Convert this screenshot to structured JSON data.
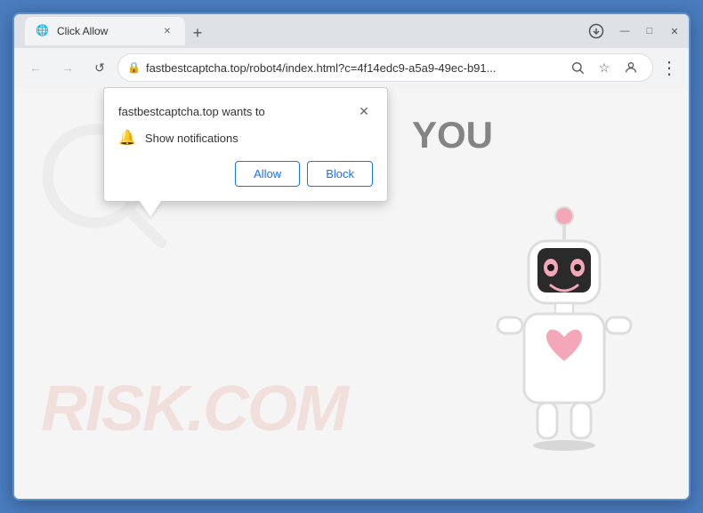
{
  "browser": {
    "title": "Click Allow",
    "tab": {
      "label": "Click Allow",
      "favicon": "🌐"
    },
    "new_tab_icon": "+",
    "download_icon": "⬇",
    "address": {
      "url": "fastbestcaptcha.top/robot4/index.html?c=4f14edc9-a5a9-49ec-b91...",
      "lock": "🔒"
    },
    "nav": {
      "back": "←",
      "forward": "→",
      "reload": "↺"
    },
    "toolbar_icons": {
      "search": "🔍",
      "star": "☆",
      "profile": "👤",
      "menu": "⋮"
    }
  },
  "window_controls": {
    "minimize": "—",
    "maximize": "□",
    "close": "✕"
  },
  "popup": {
    "title": "fastbestcaptcha.top wants to",
    "close_icon": "✕",
    "notification_text": "Show notifications",
    "allow_label": "Allow",
    "block_label": "Block"
  },
  "page": {
    "you_text": "YOU",
    "watermark": "RISK.COM"
  }
}
